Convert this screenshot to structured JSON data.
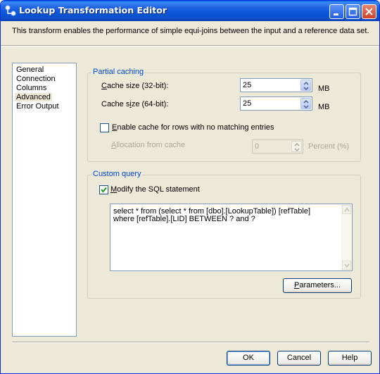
{
  "window": {
    "title": "Lookup Transformation Editor",
    "description": "This transform enables the performance of simple equi-joins between the input and a reference data set."
  },
  "nav": {
    "items": [
      {
        "label": "General"
      },
      {
        "label": "Connection"
      },
      {
        "label": "Columns"
      },
      {
        "label": "Advanced",
        "selected": true
      },
      {
        "label": "Error Output"
      }
    ]
  },
  "partial_caching": {
    "title": "Partial caching",
    "cache32": {
      "label_pre": "C",
      "label_rest": "ache size (32-bit):",
      "value": "25",
      "unit": "MB"
    },
    "cache64": {
      "label_pre": "Cache s",
      "label_u": "i",
      "label_rest": "ze (64-bit):",
      "value": "25",
      "unit": "MB"
    },
    "enable_cache": {
      "label_u": "E",
      "label_rest": "nable cache for rows with no matching entries",
      "checked": false
    },
    "allocation": {
      "label_u": "A",
      "label_rest": "llocation from cache",
      "value": "0",
      "unit": "Percent (%)",
      "enabled": false
    }
  },
  "custom_query": {
    "title": "Custom query",
    "modify_sql": {
      "label_u": "M",
      "label_rest": "odify the SQL statement",
      "checked": true
    },
    "sql_lines": [
      "select * from (select * from [dbo].[LookupTable]) [refTable]",
      "where [refTable].[LID] BETWEEN ? and ?"
    ],
    "parameters_button": {
      "label_u": "P",
      "label_rest": "arameters..."
    }
  },
  "buttons": {
    "ok": "OK",
    "cancel": "Cancel",
    "help": "Help"
  },
  "colors": {
    "title_bar": "#0a5ee6",
    "dialog_bg": "#ece9d8",
    "group_title": "#0046d5"
  }
}
